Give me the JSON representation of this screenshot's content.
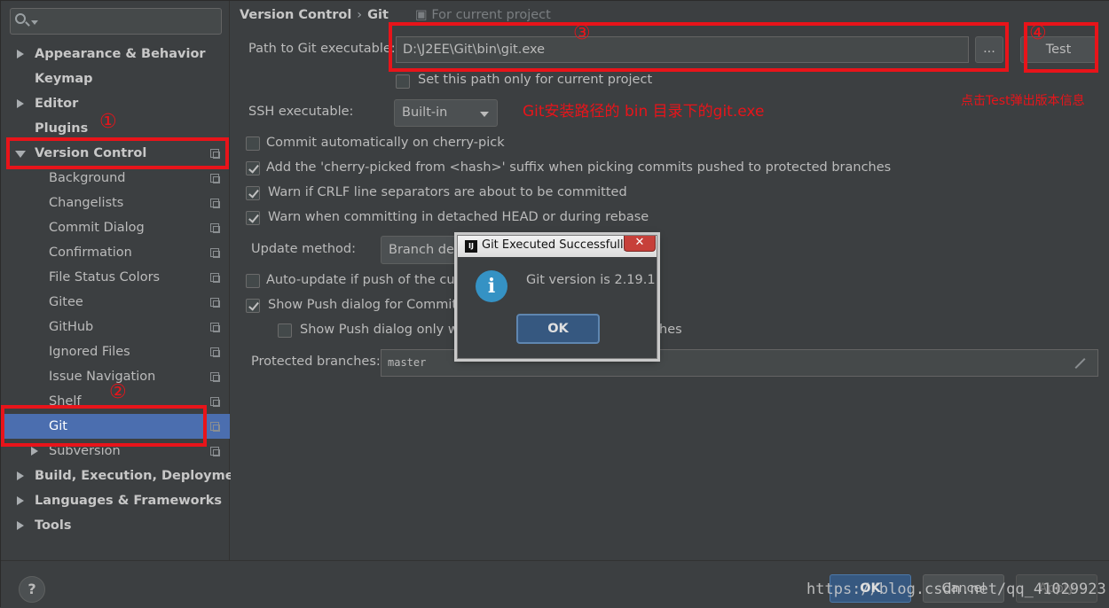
{
  "sidebar": {
    "items": [
      {
        "label": "Appearance & Behavior"
      },
      {
        "label": "Keymap"
      },
      {
        "label": "Editor"
      },
      {
        "label": "Plugins"
      },
      {
        "label": "Version Control"
      },
      {
        "label": "Background"
      },
      {
        "label": "Changelists"
      },
      {
        "label": "Commit Dialog"
      },
      {
        "label": "Confirmation"
      },
      {
        "label": "File Status Colors"
      },
      {
        "label": "Gitee"
      },
      {
        "label": "GitHub"
      },
      {
        "label": "Ignored Files"
      },
      {
        "label": "Issue Navigation"
      },
      {
        "label": "Shelf"
      },
      {
        "label": "Git"
      },
      {
        "label": "Subversion"
      },
      {
        "label": "Build, Execution, Deployment"
      },
      {
        "label": "Languages & Frameworks"
      },
      {
        "label": "Tools"
      }
    ]
  },
  "breadcrumb": {
    "parent": "Version Control",
    "separator": "›",
    "current": "Git",
    "for_project": "For current project"
  },
  "settings": {
    "path_label": "Path to Git executable:",
    "path_value": "D:\\J2EE\\Git\\bin\\git.exe",
    "browse_label": "...",
    "test_label": "Test",
    "project_only_label": "Set this path only for current project",
    "ssh_label": "SSH executable:",
    "ssh_value": "Built-in",
    "commit_cherry_label": "Commit automatically on cherry-pick",
    "cherry_suffix_label": "Add the 'cherry-picked from <hash>' suffix when picking commits pushed to protected branches",
    "crlf_label": "Warn if CRLF line separators are about to be committed",
    "detached_label": "Warn when committing in detached HEAD or during rebase",
    "update_method_label": "Update method:",
    "update_method_value": "Branch defa",
    "auto_update_label": "Auto-update if push of the curre",
    "show_push_label": "Show Push dialog for Commit a",
    "show_push_only_label": "Show Push dialog only wh",
    "show_push_only_tail": "hes",
    "protected_label": "Protected branches:",
    "protected_value": "master"
  },
  "annotations": {
    "n1": "①",
    "n2": "②",
    "n3": "③",
    "n4": "④",
    "path_note": "Git安装路径的 bin 目录下的git.exe",
    "test_note": "点击Test弹出版本信息"
  },
  "dialog": {
    "title": "Git Executed Successfully",
    "app_icon": "IJ",
    "close": "✕",
    "message": "Git version is 2.19.1",
    "info_glyph": "i",
    "ok": "OK"
  },
  "footer": {
    "help": "?",
    "ok": "OK",
    "cancel": "Cancel",
    "apply": "Apply",
    "watermark": "https://blog.csdn.net/qq_41029923"
  },
  "colors": {
    "selection": "#4b6eaf",
    "annotation_red": "#e8141a",
    "dialog_ok": "#365880"
  }
}
